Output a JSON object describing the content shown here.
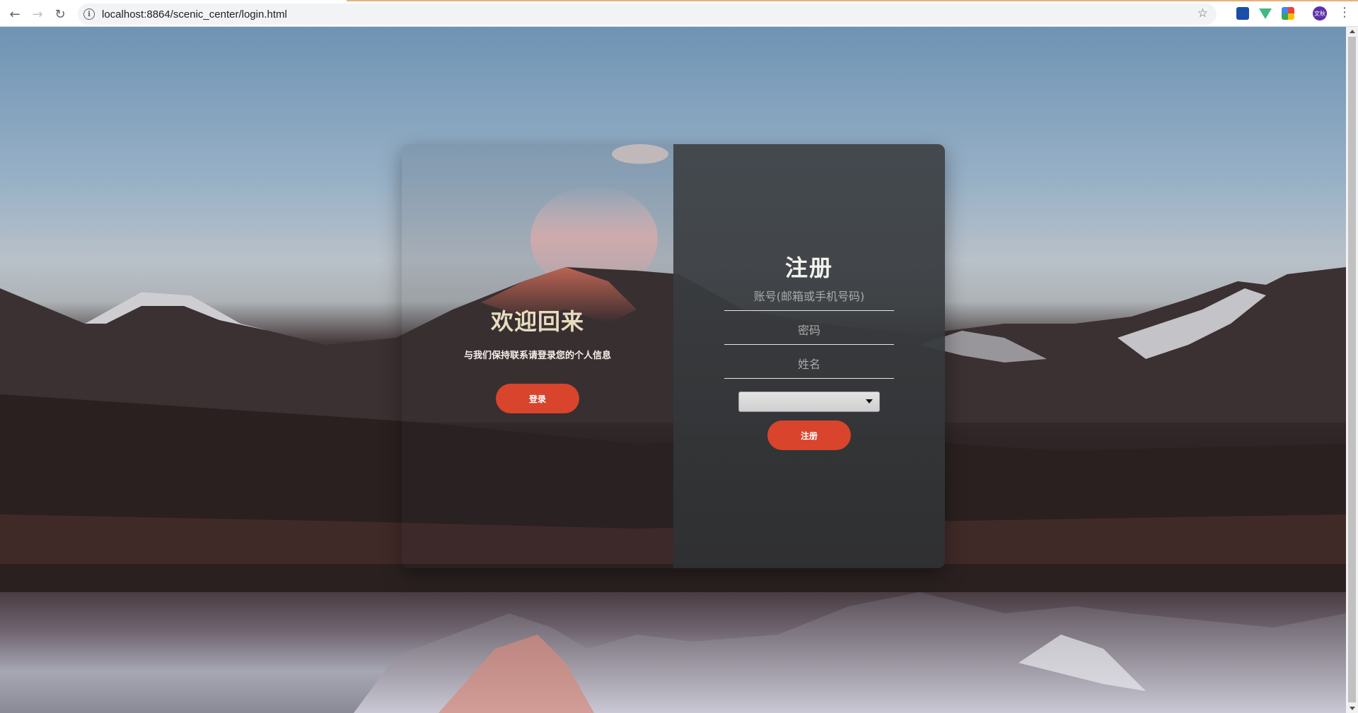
{
  "browser": {
    "url": "localhost:8864/scenic_center/login.html",
    "avatar_text": "文秋",
    "icons": {
      "back": "arrow-left-icon",
      "forward": "arrow-right-icon",
      "reload": "reload-icon",
      "info": "info-icon",
      "bookmark": "star-icon",
      "menu": "more-vertical-icon"
    }
  },
  "welcome": {
    "title": "欢迎回来",
    "subtitle": "与我们保持联系请登录您的个人信息",
    "login_button": "登录"
  },
  "register": {
    "title": "注册",
    "account_placeholder": "账号(邮箱或手机号码)",
    "password_placeholder": "密码",
    "name_placeholder": "姓名",
    "select_value": "",
    "submit_button": "注册"
  },
  "colors": {
    "accent": "#d8442c",
    "welcome_title": "#e8dcbf"
  }
}
